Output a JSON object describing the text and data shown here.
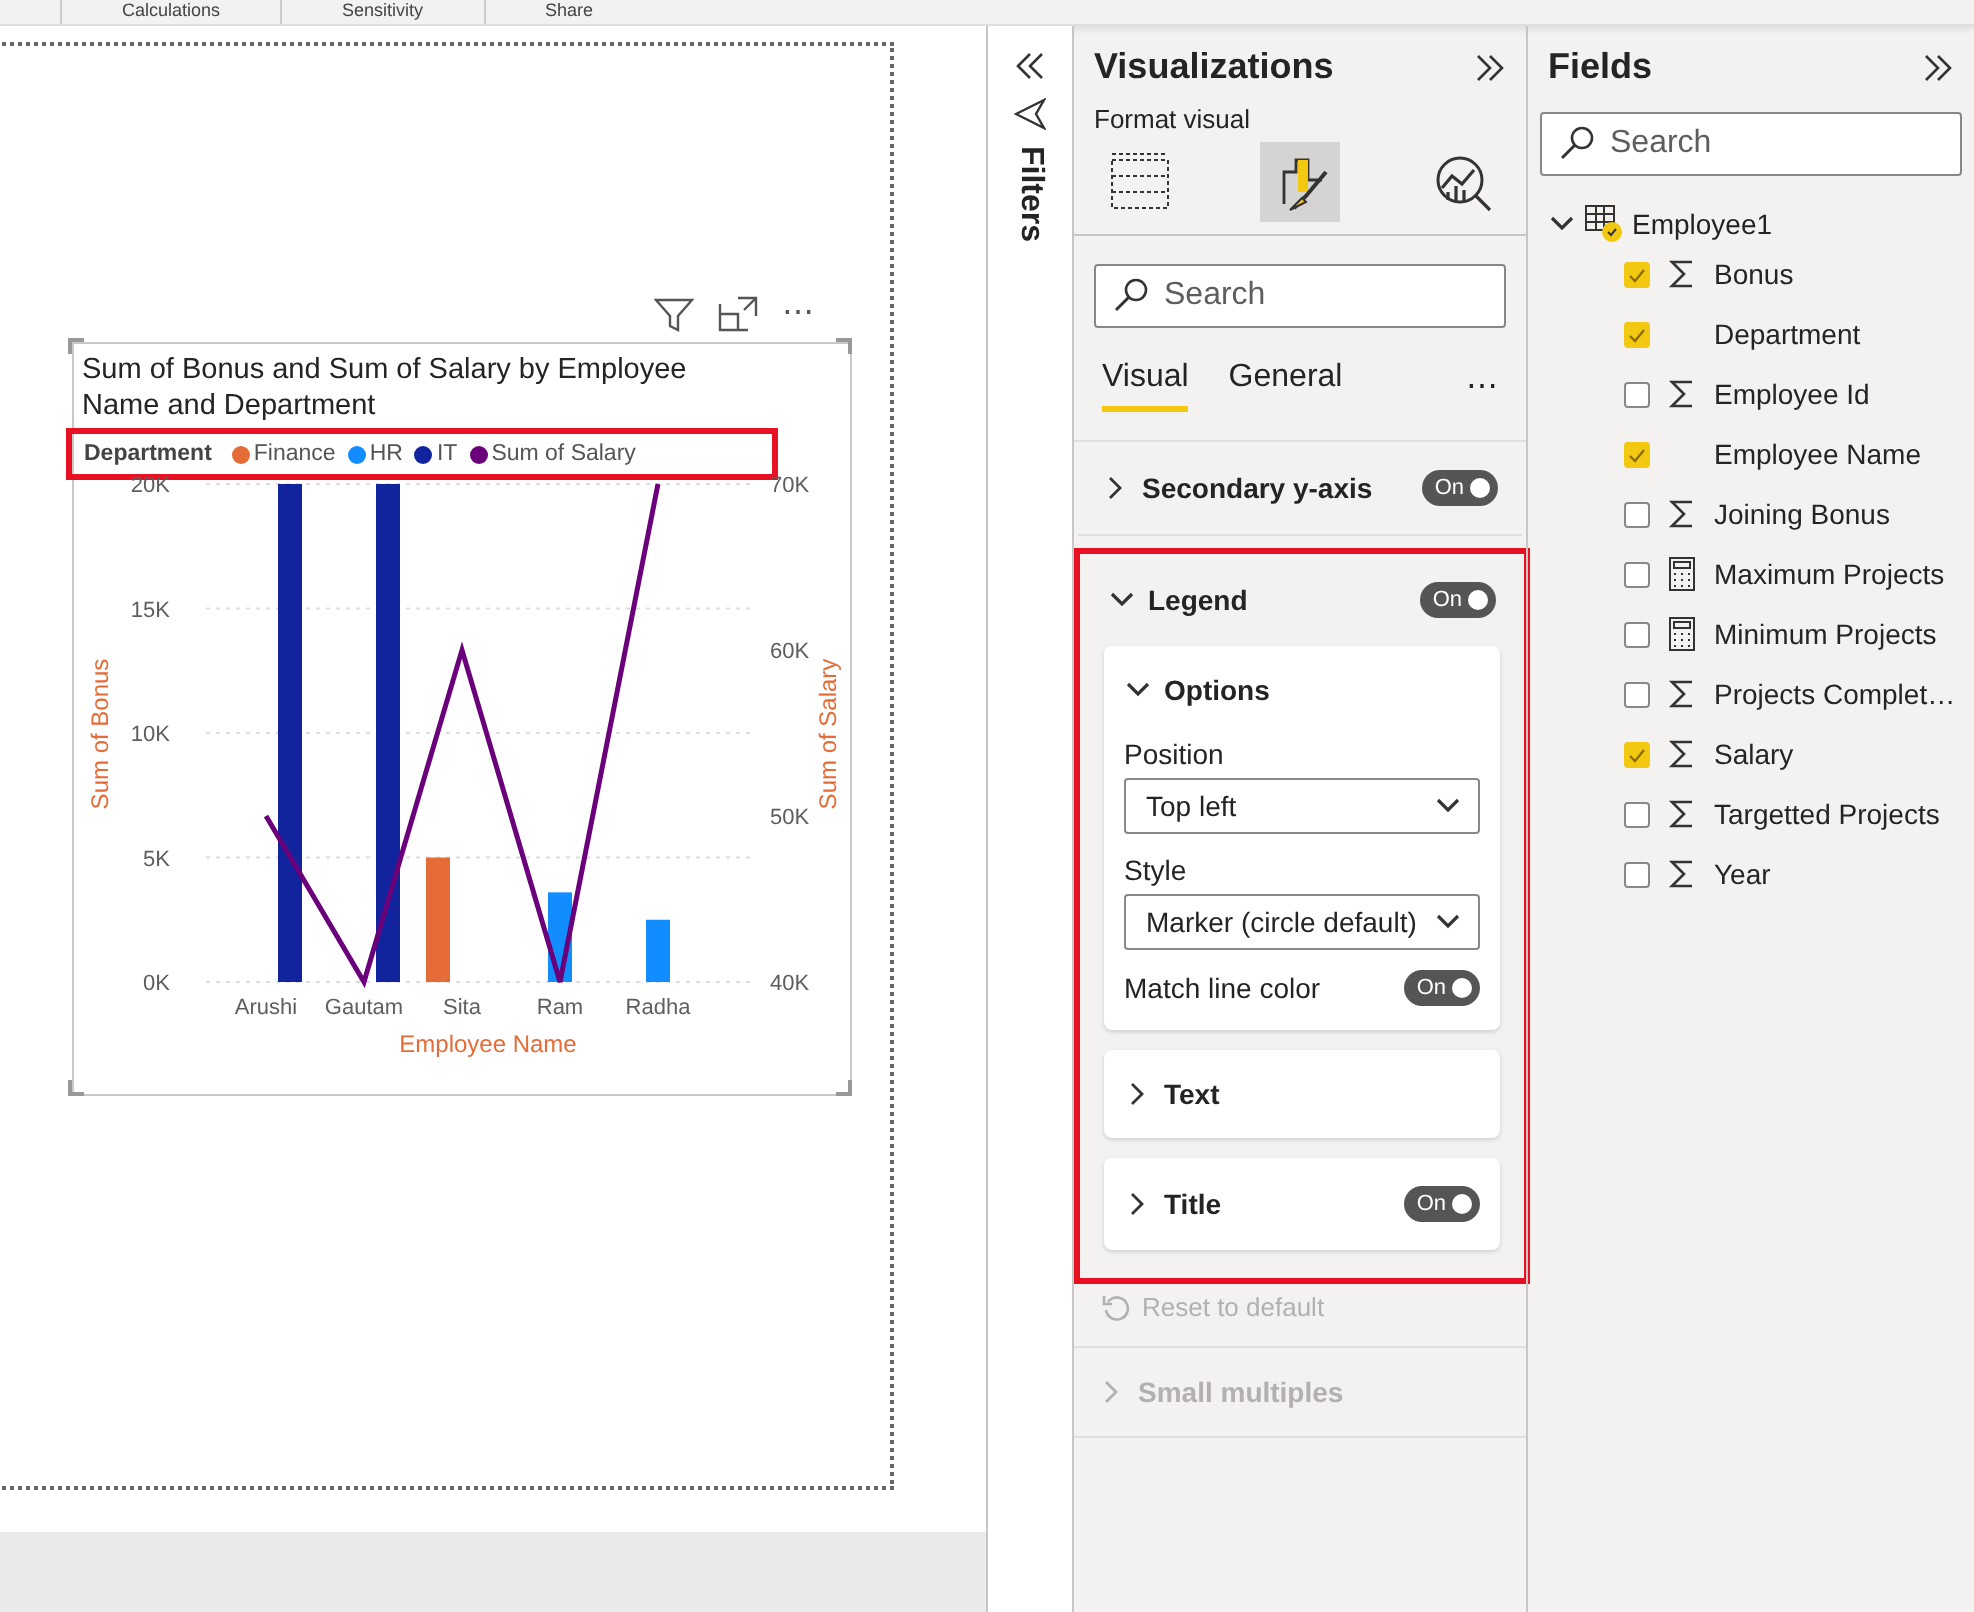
{
  "ribbon": {
    "groups": [
      "Calculations",
      "Sensitivity",
      "Share"
    ]
  },
  "visual": {
    "header_more": "⋯",
    "title": "Sum of Bonus and Sum of Salary by Employee Name and Department",
    "legend": {
      "title": "Department",
      "highlighted": true
    },
    "chart_data": {
      "type": "bar",
      "xlabel": "Employee Name",
      "ylabel": "Sum of Bonus",
      "categories": [
        "Arushi",
        "Gautam",
        "Sita",
        "Ram",
        "Radha"
      ],
      "ylim": [
        0,
        20000
      ],
      "yticks": [
        {
          "value": 0,
          "label": "0K"
        },
        {
          "value": 5000,
          "label": "5K"
        },
        {
          "value": 10000,
          "label": "10K"
        },
        {
          "value": 15000,
          "label": "15K"
        },
        {
          "value": 20000,
          "label": "20K"
        }
      ],
      "stacked": false,
      "grid": true,
      "series": [
        {
          "name": "Finance",
          "color": "#e66c37",
          "values": [
            null,
            null,
            5000,
            null,
            null
          ]
        },
        {
          "name": "HR",
          "color": "#118dff",
          "values": [
            null,
            null,
            null,
            3600,
            2500
          ]
        },
        {
          "name": "IT",
          "color": "#12239e",
          "values": [
            20000,
            20000,
            null,
            null,
            null
          ]
        }
      ]
    },
    "secondary": {
      "chart_data": {
        "type": "line",
        "ylabel": "Sum of Salary",
        "ylim": [
          40000,
          70000
        ],
        "yticks": [
          {
            "value": 40000,
            "label": "40K"
          },
          {
            "value": 50000,
            "label": "50K"
          },
          {
            "value": 60000,
            "label": "60K"
          },
          {
            "value": 70000,
            "label": "70K"
          }
        ],
        "series": [
          {
            "name": "Sum of Salary",
            "color": "#6b007b",
            "values": [
              50000,
              40000,
              60000,
              40000,
              70000
            ]
          }
        ]
      }
    }
  },
  "filters": {
    "label": "Filters"
  },
  "visualizations": {
    "title": "Visualizations",
    "subtitle": "Format visual",
    "modes": [
      {
        "kind": "build",
        "selected": false
      },
      {
        "kind": "format",
        "selected": true
      },
      {
        "kind": "analytics",
        "selected": false
      }
    ],
    "search": {
      "placeholder": "Search"
    },
    "tabs": [
      {
        "label": "Visual",
        "selected": true
      },
      {
        "label": "General",
        "selected": false
      }
    ],
    "more": "⋯",
    "sections": [
      {
        "label": "Secondary y-axis",
        "expanded": false,
        "toggle": "On",
        "on": true,
        "highlighted": false
      },
      {
        "label": "Legend",
        "expanded": true,
        "toggle": "On",
        "on": true,
        "highlighted": true,
        "cards": [
          {
            "label": "Options",
            "expanded": true,
            "rows": [
              {
                "kind": "dropdown",
                "label": "Position",
                "value": "Top left"
              },
              {
                "kind": "dropdown",
                "label": "Style",
                "value": "Marker (circle default)"
              },
              {
                "kind": "toggle",
                "label": "Match line color",
                "toggle": "On",
                "on": true
              }
            ]
          },
          {
            "label": "Text",
            "expanded": false
          },
          {
            "label": "Title",
            "expanded": false,
            "toggle": "On",
            "on": true
          }
        ]
      }
    ],
    "reset": {
      "label": "Reset to default",
      "disabled": true
    },
    "small_multiples": {
      "label": "Small multiples",
      "disabled": true
    }
  },
  "fields": {
    "title": "Fields",
    "search": {
      "placeholder": "Search"
    },
    "tables": [
      {
        "name": "Employee1",
        "expanded": true,
        "children": [
          {
            "label": "Bonus",
            "kind": "sigma",
            "checked": true
          },
          {
            "label": "Department",
            "kind": "text",
            "checked": true
          },
          {
            "label": "Employee Id",
            "kind": "sigma",
            "checked": false
          },
          {
            "label": "Employee Name",
            "kind": "text",
            "checked": true
          },
          {
            "label": "Joining Bonus",
            "kind": "sigma",
            "checked": false
          },
          {
            "label": "Maximum Projects",
            "kind": "calculator",
            "checked": false
          },
          {
            "label": "Minimum Projects",
            "kind": "calculator",
            "checked": false
          },
          {
            "label": "Projects Complet…",
            "kind": "sigma",
            "checked": false
          },
          {
            "label": "Salary",
            "kind": "sigma",
            "checked": true
          },
          {
            "label": "Targetted Projects",
            "kind": "sigma",
            "checked": false
          },
          {
            "label": "Year",
            "kind": "sigma",
            "checked": false
          }
        ]
      }
    ]
  }
}
